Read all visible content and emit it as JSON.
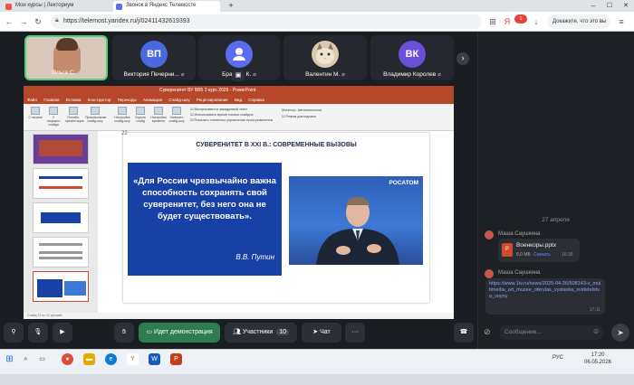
{
  "browser": {
    "tabs": [
      {
        "label": "Мои курсы | Лекториум",
        "icon": "lectorium-icon",
        "color": "#e8544e"
      },
      {
        "label": "Звонок в Яндекс Телемосте",
        "icon": "telemost-icon",
        "color": "#5a6cf0"
      }
    ],
    "new_tab": "+",
    "window_controls": {
      "minimize": "–",
      "maximize": "☐",
      "close": "✕"
    },
    "url": "https://telemost.yandex.ru/j/02411432619393",
    "search_placeholder": "Докажите, что это вы",
    "badge_count": "1"
  },
  "participants": [
    {
      "name": "Ольга С.",
      "initials": "",
      "avatar_color": "#d9a48c",
      "highlighted": true
    },
    {
      "name": "Виктория Печерни...",
      "initials": "ВП",
      "avatar_color": "#4a68e0"
    },
    {
      "name": "Брагина К.",
      "initials": "",
      "avatar_color": "#5a6cf0"
    },
    {
      "name": "Валентин М.",
      "initials": "",
      "avatar_color": "#c9b89a"
    },
    {
      "name": "Владимир Королев",
      "initials": "ВК",
      "avatar_color": "#6a4fd8"
    }
  ],
  "share": {
    "ppt_title": "Суверенитет ВУ ВВ5 3 курс 2025 - PowerPoint",
    "ppt_menu": "Файл Главная Вставка Конструктор Переходы Анимация Слайд-шоу Рецензирование Вид Справка",
    "ribbon_buttons": [
      "С начала",
      "С текущего слайда",
      "Онлайн-презентация",
      "Произвольная слайд-шоу",
      "Настройка слайд-шоу",
      "Скрыть слайд",
      "Настройка времени",
      "Записать слайд-шоу"
    ],
    "ribbon_checks": [
      "Воспроизвести закадровый текст",
      "Использовать время показа слайдов",
      "Показать элементы управления проигрывателем"
    ],
    "monitor_label": "Монитор: Автоматически",
    "presenter_label": "Режим докладчика",
    "slide_number": "22",
    "slide_title": "СУВЕРЕНИТЕТ В XXI В.: СОВРЕМЕННЫЕ ВЫЗОВЫ",
    "quote": "«Для России чрезвычайно важна способность сохранять свой суверенитет, без него она не будет существовать».",
    "quote_author": "В.В. Путин",
    "photo_caption": "РОСАТОМ",
    "status_text": "Слайд 22 из 22   русский"
  },
  "chat": {
    "date": "27 апреля",
    "messages": [
      {
        "sender": "Маша Саушкина",
        "file_name": "Военкоры.pptx",
        "file_size": "8,0 МБ",
        "file_action": "Скачать",
        "time": "16:38"
      },
      {
        "sender": "Маша Саушкина",
        "link": "https://www.1tv.ru/news/2025-04-26/508143-v_multimedia_art_muzee_otkrylas_vystavka_svidetelstva_voyny",
        "time": "17:11"
      }
    ],
    "composer_placeholder": "Сообщение..."
  },
  "controls": {
    "demo_label": "Идет демонстрация",
    "participants_label": "Участники",
    "participants_count": "10",
    "chat_label": "Чат",
    "more": "···"
  },
  "taskbar": {
    "time": "17:20",
    "date": "06.05.2026",
    "lang": "РУС"
  }
}
